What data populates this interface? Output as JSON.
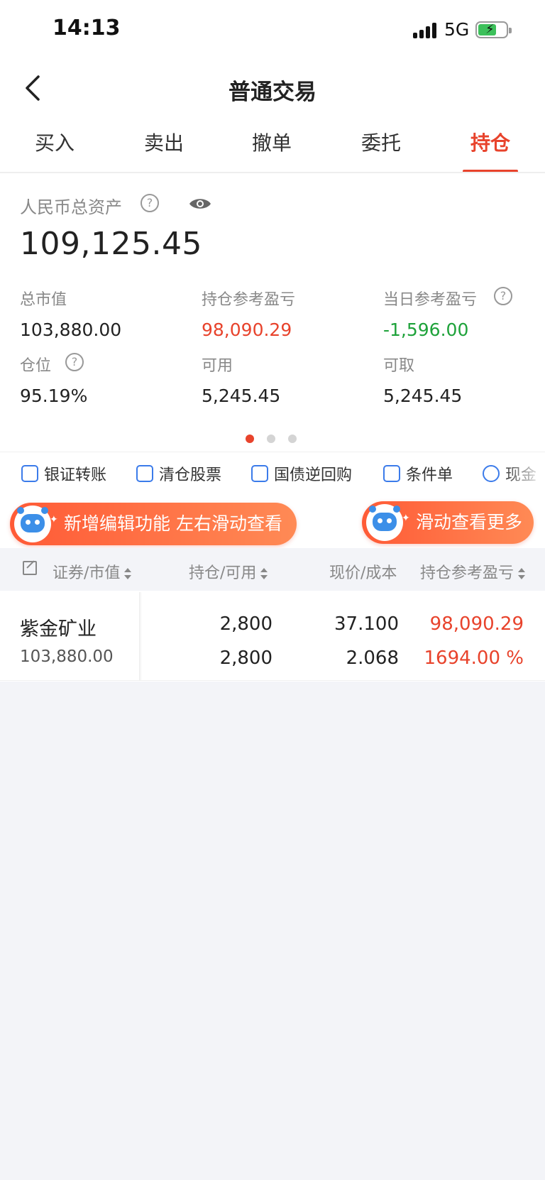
{
  "status_bar": {
    "time": "14:13",
    "network": "5G"
  },
  "header": {
    "title": "普通交易"
  },
  "tabs": [
    {
      "label": "买入"
    },
    {
      "label": "卖出"
    },
    {
      "label": "撤单"
    },
    {
      "label": "委托"
    },
    {
      "label": "持仓",
      "active": true
    }
  ],
  "assets": {
    "total_label": "人民币总资产",
    "total_value": "109,125.45",
    "metrics": [
      {
        "label": "总市值",
        "value": "103,880.00"
      },
      {
        "label": "持仓参考盈亏",
        "value": "98,090.29"
      },
      {
        "label": "当日参考盈亏",
        "value": "-1,596.00"
      },
      {
        "label": "仓位",
        "value": "95.19%"
      },
      {
        "label": "可用",
        "value": "5,245.45"
      },
      {
        "label": "可取",
        "value": "5,245.45"
      }
    ],
    "help_glyph": "?"
  },
  "quick_actions": [
    {
      "label": "银证转账",
      "icon": "transfer-icon"
    },
    {
      "label": "清仓股票",
      "icon": "chart-icon"
    },
    {
      "label": "国债逆回购",
      "icon": "repo-icon"
    },
    {
      "label": "条件单",
      "icon": "condition-order-icon"
    },
    {
      "label": "现金",
      "icon": "cash-icon"
    }
  ],
  "tips": {
    "left": "新增编辑功能 左右滑动查看",
    "right": "滑动查看更多"
  },
  "table": {
    "headers": [
      "证券/市值",
      "持仓/可用",
      "现价/成本",
      "持仓参考盈亏"
    ],
    "rows": [
      {
        "name": "紫金矿业",
        "market_value": "103,880.00",
        "position": "2,800",
        "available": "2,800",
        "price": "37.100",
        "cost": "2.068",
        "pnl": "98,090.29",
        "pnl_pct": "1694.00 %"
      }
    ]
  },
  "colors": {
    "accent": "#e8432c",
    "loss_green": "#1ea23a",
    "link_blue": "#3b7bea"
  }
}
